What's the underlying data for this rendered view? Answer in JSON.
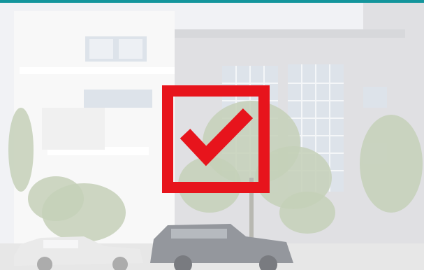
{
  "colors": {
    "top_bar": "#13959c",
    "sky": "#eef0f3",
    "left_building": "#f7f7f7",
    "right_building": "#d9dadd",
    "window_frame": "#d6dde6",
    "window_glass": "#e9edf2",
    "tree": "#b9c7a9",
    "ground": "#e2e2e2",
    "car_silver": "#e6e6e6",
    "suv_dark": "#7d8188",
    "checkmark": "#e7141c"
  },
  "overlay": {
    "icon": "checkmark-in-square-icon",
    "state": "checked"
  }
}
